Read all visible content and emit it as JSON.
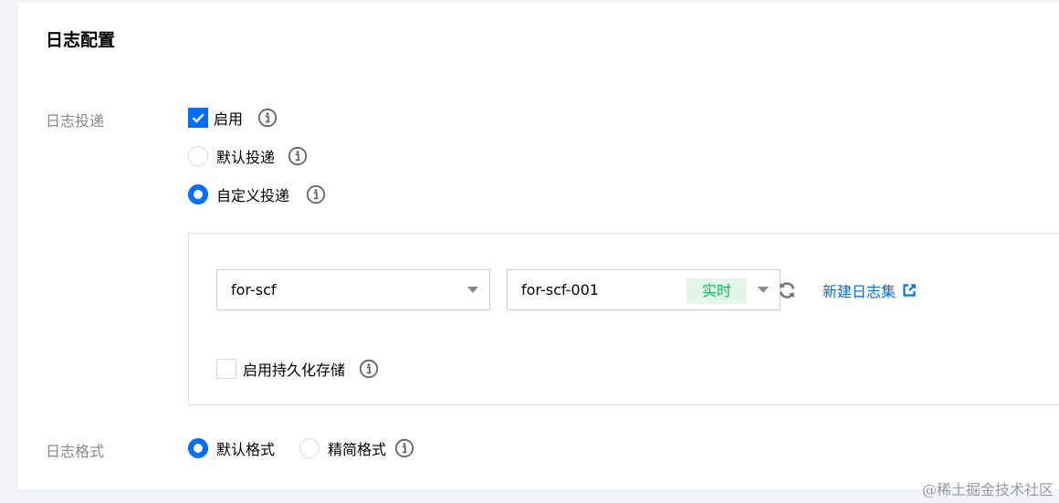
{
  "section": {
    "title": "日志配置"
  },
  "log_delivery": {
    "label": "日志投递",
    "enable": {
      "label": "启用",
      "checked": true
    },
    "default_delivery": {
      "label": "默认投递",
      "selected": false
    },
    "custom_delivery": {
      "label": "自定义投递",
      "selected": true
    },
    "logset_select": {
      "value": "for-scf"
    },
    "topic_select": {
      "value": "for-scf-001",
      "tag": "实时"
    },
    "create_logset": {
      "label": "新建日志集"
    },
    "persistent_storage": {
      "label": "启用持久化存储",
      "checked": false
    }
  },
  "log_format": {
    "label": "日志格式",
    "default_format": {
      "label": "默认格式",
      "selected": true
    },
    "simple_format": {
      "label": "精简格式",
      "selected": false
    }
  },
  "watermark": "@稀土掘金技术社区",
  "colors": {
    "primary": "#006eff",
    "tag_text": "#0abf5b",
    "tag_bg": "#e3f6e9",
    "label_gray": "#888888"
  }
}
